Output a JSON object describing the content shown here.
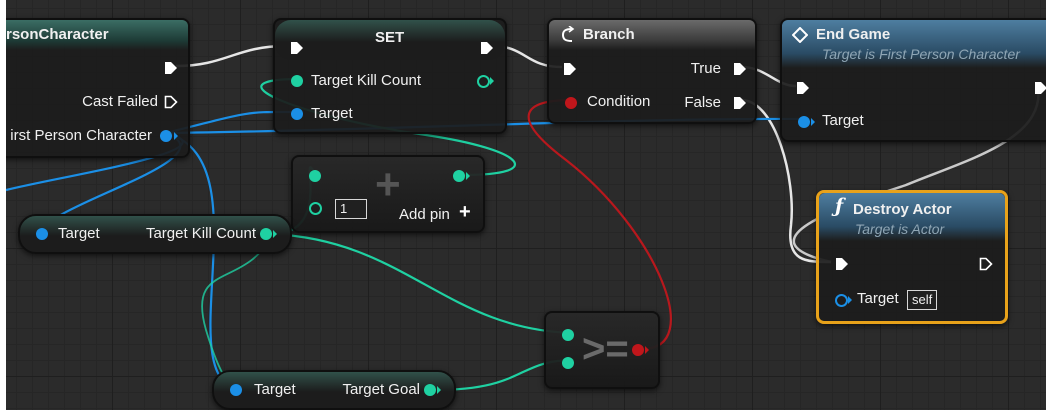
{
  "nodes": {
    "cast": {
      "title": "rsonCharacter",
      "cast_failed": "Cast Failed",
      "as_output": "irst Person Character"
    },
    "set": {
      "title": "SET",
      "var_in": "Target Kill Count",
      "target": "Target"
    },
    "branch": {
      "title": "Branch",
      "true_label": "True",
      "false_label": "False",
      "condition": "Condition"
    },
    "end_game": {
      "title": "End Game",
      "subtitle": "Target is First Person Character",
      "target": "Target"
    },
    "destroy_actor": {
      "title": "Destroy Actor",
      "subtitle": "Target is Actor",
      "target": "Target",
      "self_value": "self"
    },
    "add": {
      "default_value": "1",
      "add_pin": "Add pin"
    },
    "get_kill_count": {
      "target": "Target",
      "output": "Target Kill Count"
    },
    "get_goal": {
      "target": "Target",
      "output": "Target Goal"
    },
    "compare": {
      "operator": ">="
    }
  },
  "colors": {
    "exec": "#ffffff",
    "object_pin": "#1b8fe6",
    "integer_pin": "#1fd1a2",
    "boolean_pin": "#c0161b",
    "selected_outline": "#e8a21a",
    "function_header": "#4e7ea0"
  },
  "icons": [
    "branch-icon",
    "event-diamond-icon",
    "function-icon",
    "plus-icon",
    "exec-pin-icon"
  ]
}
